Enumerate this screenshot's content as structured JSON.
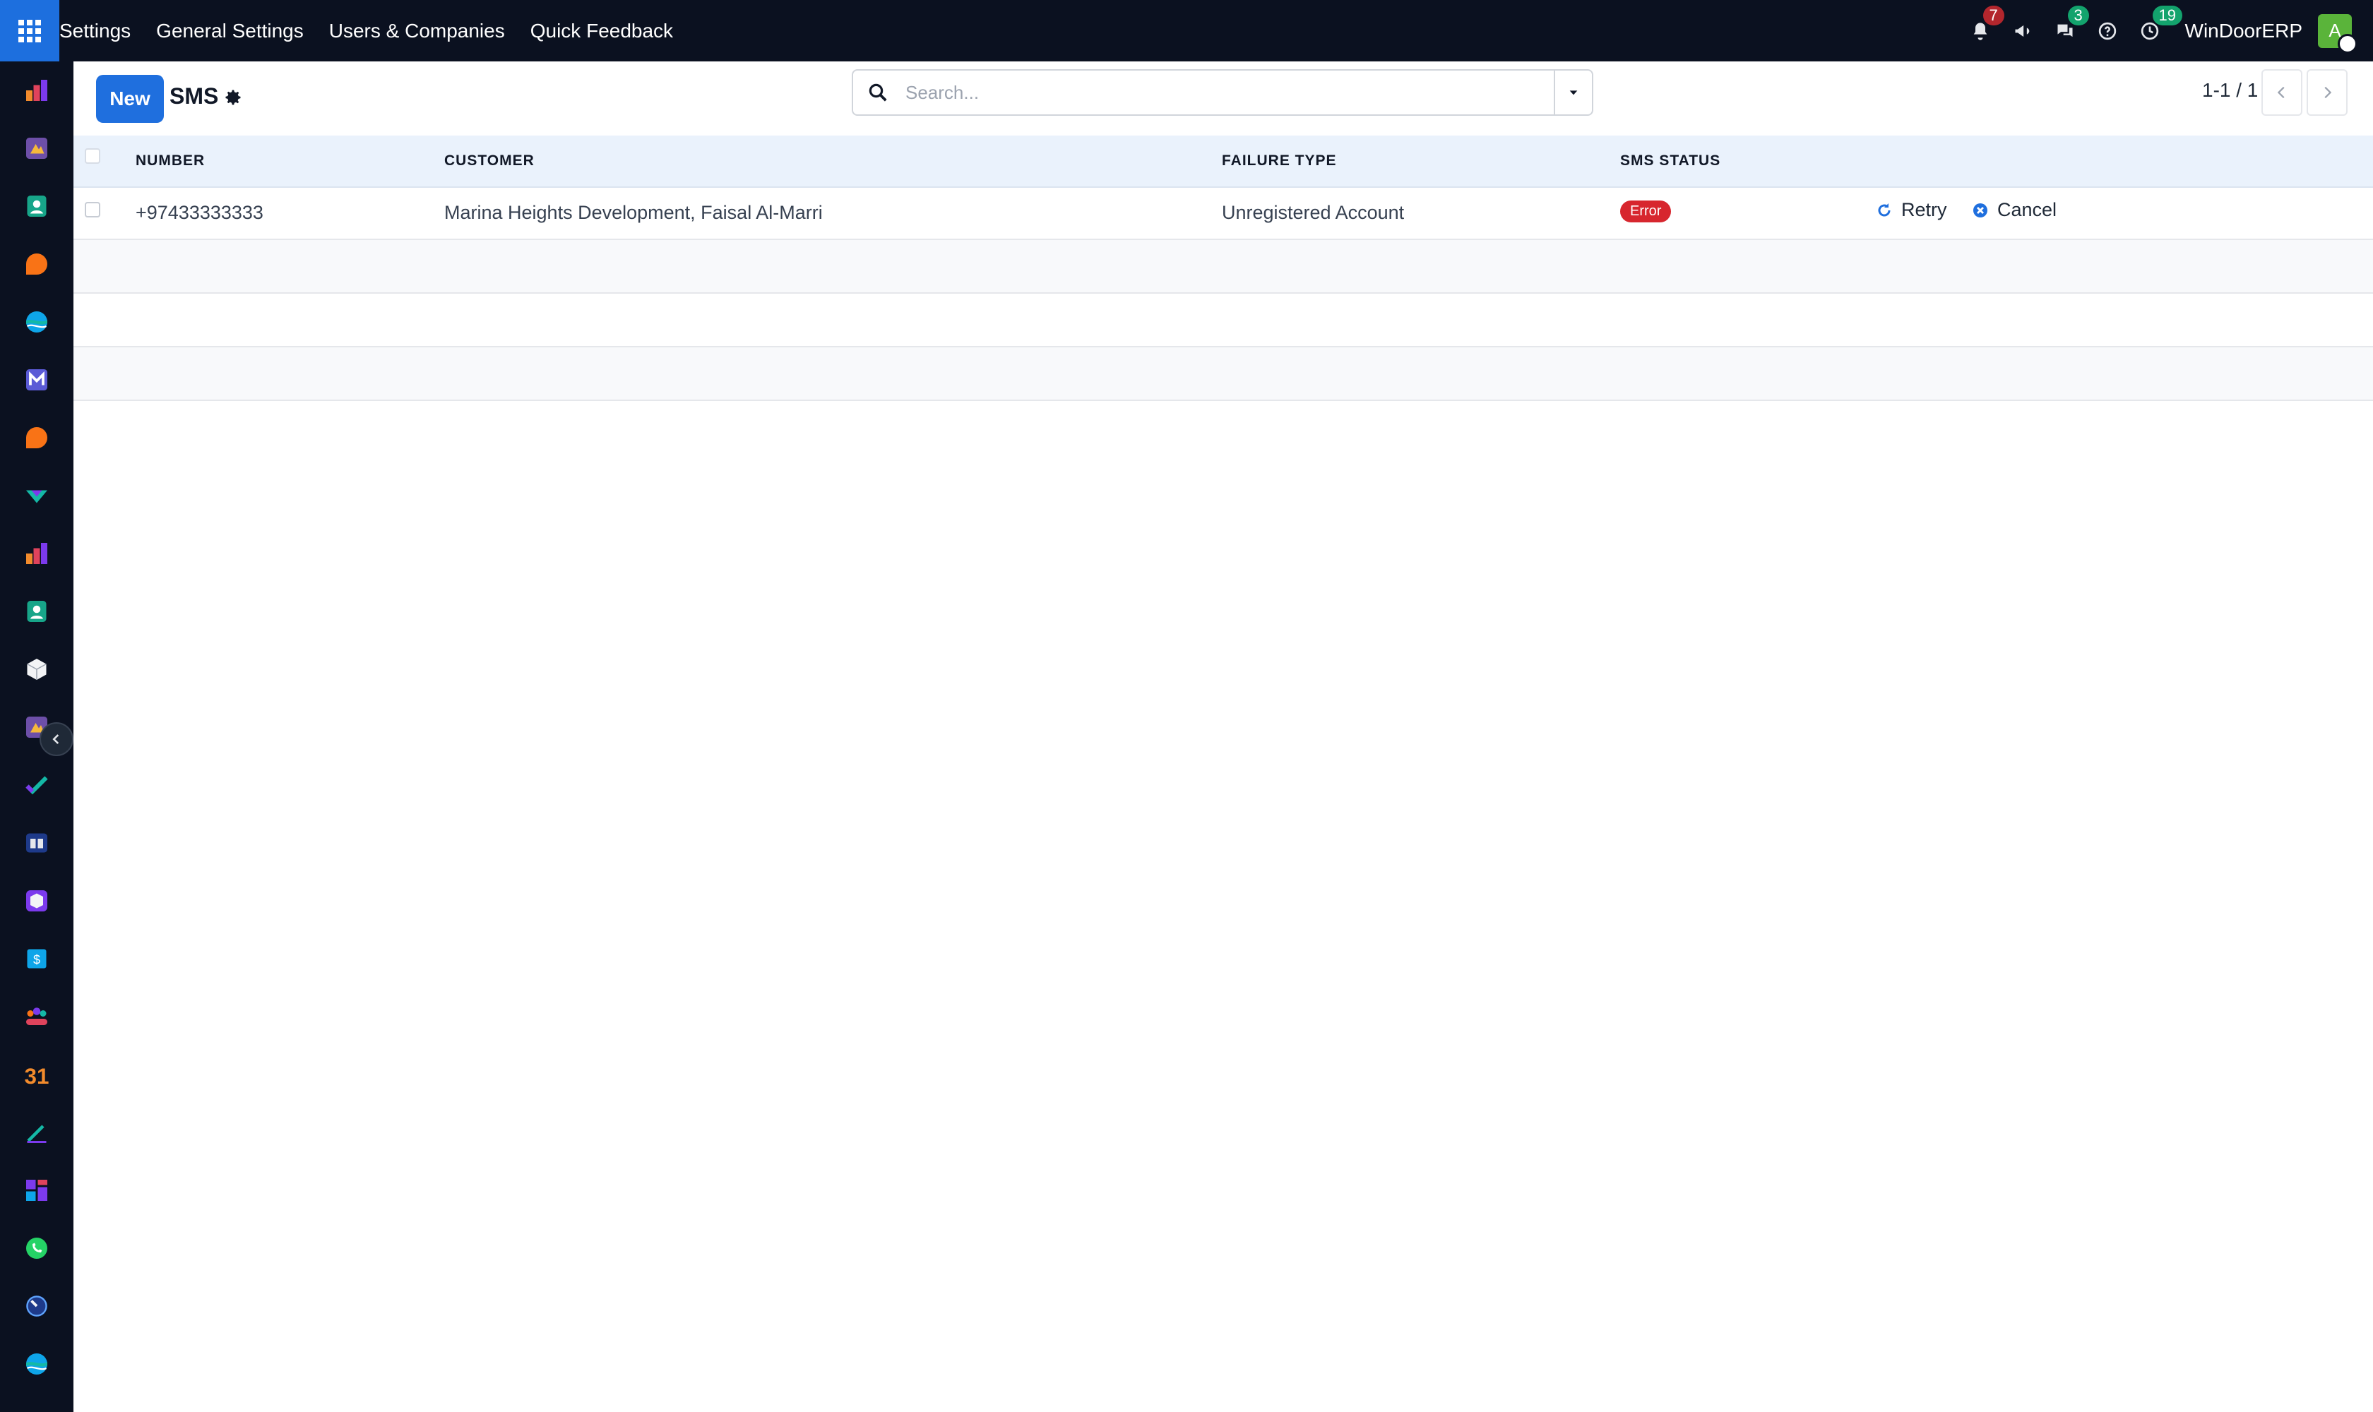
{
  "topbar": {
    "menu": [
      "Settings",
      "General Settings",
      "Users & Companies",
      "Quick Feedback"
    ],
    "notifications_count": "7",
    "messages_count": "3",
    "activities_count": "19",
    "company_name": "WinDoorERP",
    "avatar_letter": "A"
  },
  "control_panel": {
    "new_label": "New",
    "title": "SMS",
    "search_placeholder": "Search...",
    "pager": "1-1 / 1"
  },
  "table": {
    "columns": [
      "NUMBER",
      "CUSTOMER",
      "FAILURE TYPE",
      "SMS STATUS"
    ],
    "rows": [
      {
        "number": "+97433333333",
        "customer": "Marina Heights Development, Faisal Al-Marri",
        "failure_type": "Unregistered Account",
        "status": "Error",
        "retry_label": "Retry",
        "cancel_label": "Cancel"
      }
    ]
  },
  "sidebar_icons": [
    "accounting-app-icon",
    "documents-app-icon",
    "contacts-app-icon",
    "discuss-app-icon",
    "website-app-icon",
    "email-marketing-app-icon",
    "live-chat-app-icon",
    "sign-app-icon",
    "reporting-app-icon",
    "employees-app-icon",
    "inventory-app-icon",
    "knowledge-app-icon",
    "project-app-icon",
    "elearning-app-icon",
    "product-app-icon",
    "expenses-app-icon",
    "crm-team-app-icon",
    "calendar-app-icon",
    "approvals-app-icon",
    "dashboards-app-icon",
    "whatsapp-app-icon",
    "timesheets-app-icon",
    "website-2-app-icon"
  ],
  "colors": {
    "topbar": "#0b1120",
    "primary": "#1f6fde",
    "header_row": "#eaf2fc",
    "error": "#d7262e"
  }
}
